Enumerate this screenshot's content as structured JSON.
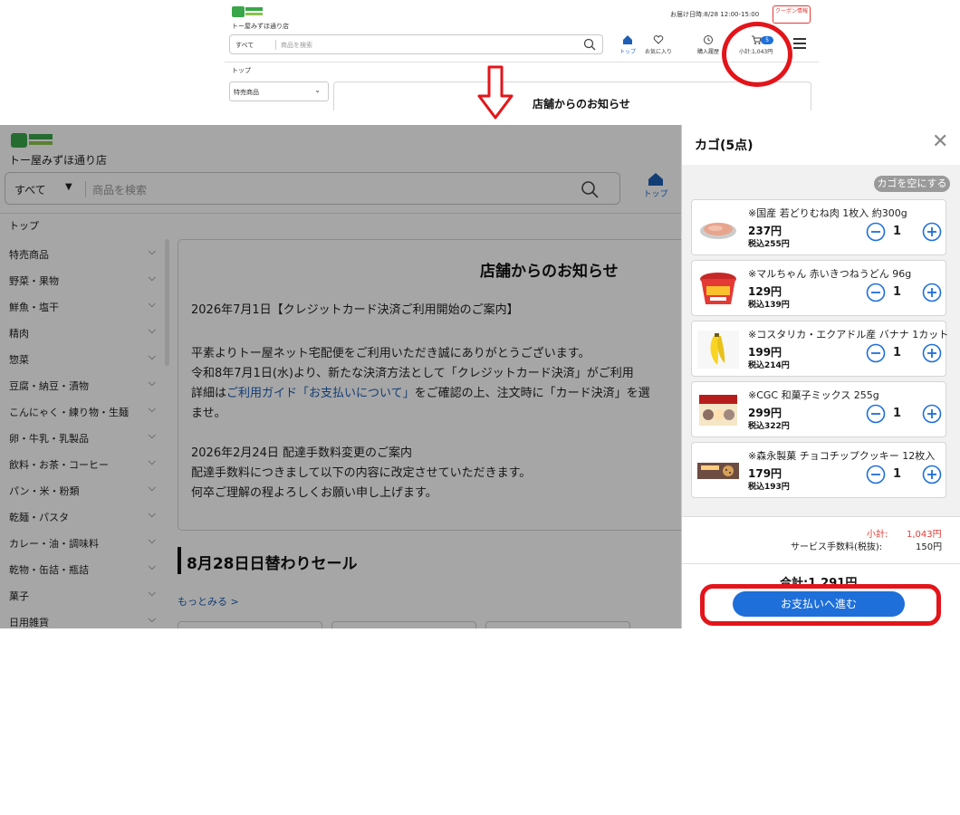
{
  "top_screenshot": {
    "store_name": "トー屋みずほ通り店",
    "delivery": "お届け日時:8/28 12:00-15:00",
    "coupon": "クーポン情報",
    "search": {
      "category": "すべて",
      "placeholder": "商品を検索"
    },
    "nav": [
      {
        "label": "トップ",
        "icon": "home-icon"
      },
      {
        "label": "お気に入り",
        "icon": "heart-icon"
      },
      {
        "label": "購入履歴",
        "icon": "history-icon"
      },
      {
        "label": "小計:1,043円",
        "icon": "cart-icon",
        "badge": "5"
      }
    ],
    "breadcrumb": "トップ",
    "select": "特売商品",
    "panel_title": "店舗からのお知らせ"
  },
  "main": {
    "store_name": "トー屋みずほ通り店",
    "search": {
      "category": "すべて",
      "placeholder": "商品を検索"
    },
    "top_nav_label": "トップ",
    "breadcrumb": "トップ",
    "sidebar": [
      "特売商品",
      "野菜・果物",
      "鮮魚・塩干",
      "精肉",
      "惣菜",
      "豆腐・納豆・漬物",
      "こんにゃく・練り物・生麺",
      "卵・牛乳・乳製品",
      "飲料・お茶・コーヒー",
      "パン・米・粉類",
      "乾麺・パスタ",
      "カレー・油・調味料",
      "乾物・缶詰・瓶詰",
      "菓子",
      "日用雑貨"
    ],
    "notice": {
      "title": "店舗からのお知らせ",
      "line1": "2026年7月1日【クレジットカード決済ご利用開始のご案内】",
      "line2": "平素よりトー屋ネット宅配便をご利用いただき誠にありがとうございます。",
      "line3": "令和8年7月1日(水)より、新たな決済方法として「クレジットカード決済」がご利用",
      "line4_pre": "詳細は",
      "line4_link": "ご利用ガイド「お支払いについて」",
      "line4_post": "をご確認の上、注文時に「カード決済」を選",
      "line5": "ませ。",
      "line6": "2026年2月24日 配達手数料変更のご案内",
      "line7": "配達手数料につきまして以下の内容に改定させていただきます。",
      "line8": "何卒ご理解の程よろしくお願い申し上げます。"
    },
    "sale_title": "8月28日日替わりセール",
    "more_link": "もっとみる >"
  },
  "cart": {
    "title": "カゴ(5点)",
    "empty_button": "カゴを空にする",
    "items": [
      {
        "name": "※国産 若どりむね肉 1枚入 約300g",
        "price": "237円",
        "tax": "税込255円",
        "qty": "1"
      },
      {
        "name": "※マルちゃん 赤いきつねうどん 96g",
        "price": "129円",
        "tax": "税込139円",
        "qty": "1"
      },
      {
        "name": "※コスタリカ・エクアドル産 バナナ 1カット",
        "price": "199円",
        "tax": "税込214円",
        "qty": "1"
      },
      {
        "name": "※CGC 和菓子ミックス 255g",
        "price": "299円",
        "tax": "税込322円",
        "qty": "1"
      },
      {
        "name": "※森永製菓 チョコチップクッキー 12枚入",
        "price": "179円",
        "tax": "税込193円",
        "qty": "1"
      }
    ],
    "subtotal_label": "小計:",
    "subtotal_value": "1,043円",
    "fee_label": "サービス手数料(税抜):",
    "fee_value": "150円",
    "total": "合計:1,291円",
    "pay_button": "お支払いへ進む"
  },
  "colors": {
    "accent": "#1e6fd9",
    "highlight": "#e3151a",
    "subtotal": "#e53935"
  }
}
